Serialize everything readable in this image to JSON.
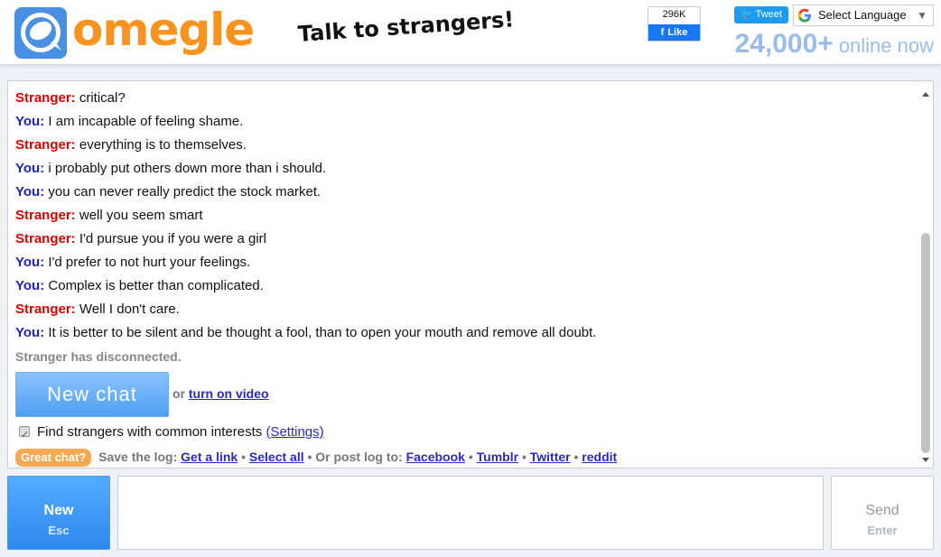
{
  "header": {
    "logo_text": "omegle",
    "tagline": "Talk to strangers!",
    "facebook": {
      "count": "296K",
      "like_label": "Like"
    },
    "tweet_label": "Tweet",
    "language": {
      "label": "Select Language",
      "arrow": "▼"
    },
    "online": {
      "count": "24,000+",
      "label": "online now"
    }
  },
  "chat": {
    "messages": [
      {
        "sender": "Stranger:",
        "text": "critical?"
      },
      {
        "sender": "You:",
        "text": "I am incapable of feeling shame."
      },
      {
        "sender": "Stranger:",
        "text": "everything is to themselves."
      },
      {
        "sender": "You:",
        "text": "i probably put others down more than i should."
      },
      {
        "sender": "You:",
        "text": "you can never really predict the stock market."
      },
      {
        "sender": "Stranger:",
        "text": "well you seem smart"
      },
      {
        "sender": "Stranger:",
        "text": "I'd pursue you if you were a girl"
      },
      {
        "sender": "You:",
        "text": "I'd prefer to not hurt your feelings."
      },
      {
        "sender": "You:",
        "text": "Complex is better than complicated."
      },
      {
        "sender": "Stranger:",
        "text": "Well I don't care."
      },
      {
        "sender": "You:",
        "text": "It is better to be silent and be thought a fool, than to open your mouth and remove all doubt."
      }
    ],
    "status": "Stranger has disconnected.",
    "new_chat_label": "New chat",
    "or_text": "or",
    "video_link": "turn on video",
    "interests_label": "Find strangers with common interests",
    "settings_link": "(Settings)",
    "great_chat_label": "Great chat?",
    "save_log_label": "Save the log:",
    "get_link": "Get a link",
    "select_all": "Select all",
    "post_log_label": "• Or post log to:",
    "bullet": "•",
    "share": [
      "Facebook",
      "Tumblr",
      "Twitter",
      "reddit"
    ]
  },
  "controls": {
    "new_label": "New",
    "new_hint": "Esc",
    "message_value": "",
    "send_label": "Send",
    "send_hint": "Enter"
  },
  "colors": {
    "accent": "#f7931e",
    "stranger": "#e00000",
    "you": "#1f21c0",
    "online": "#9bbbeb",
    "button_blue": "#2e88ec"
  }
}
